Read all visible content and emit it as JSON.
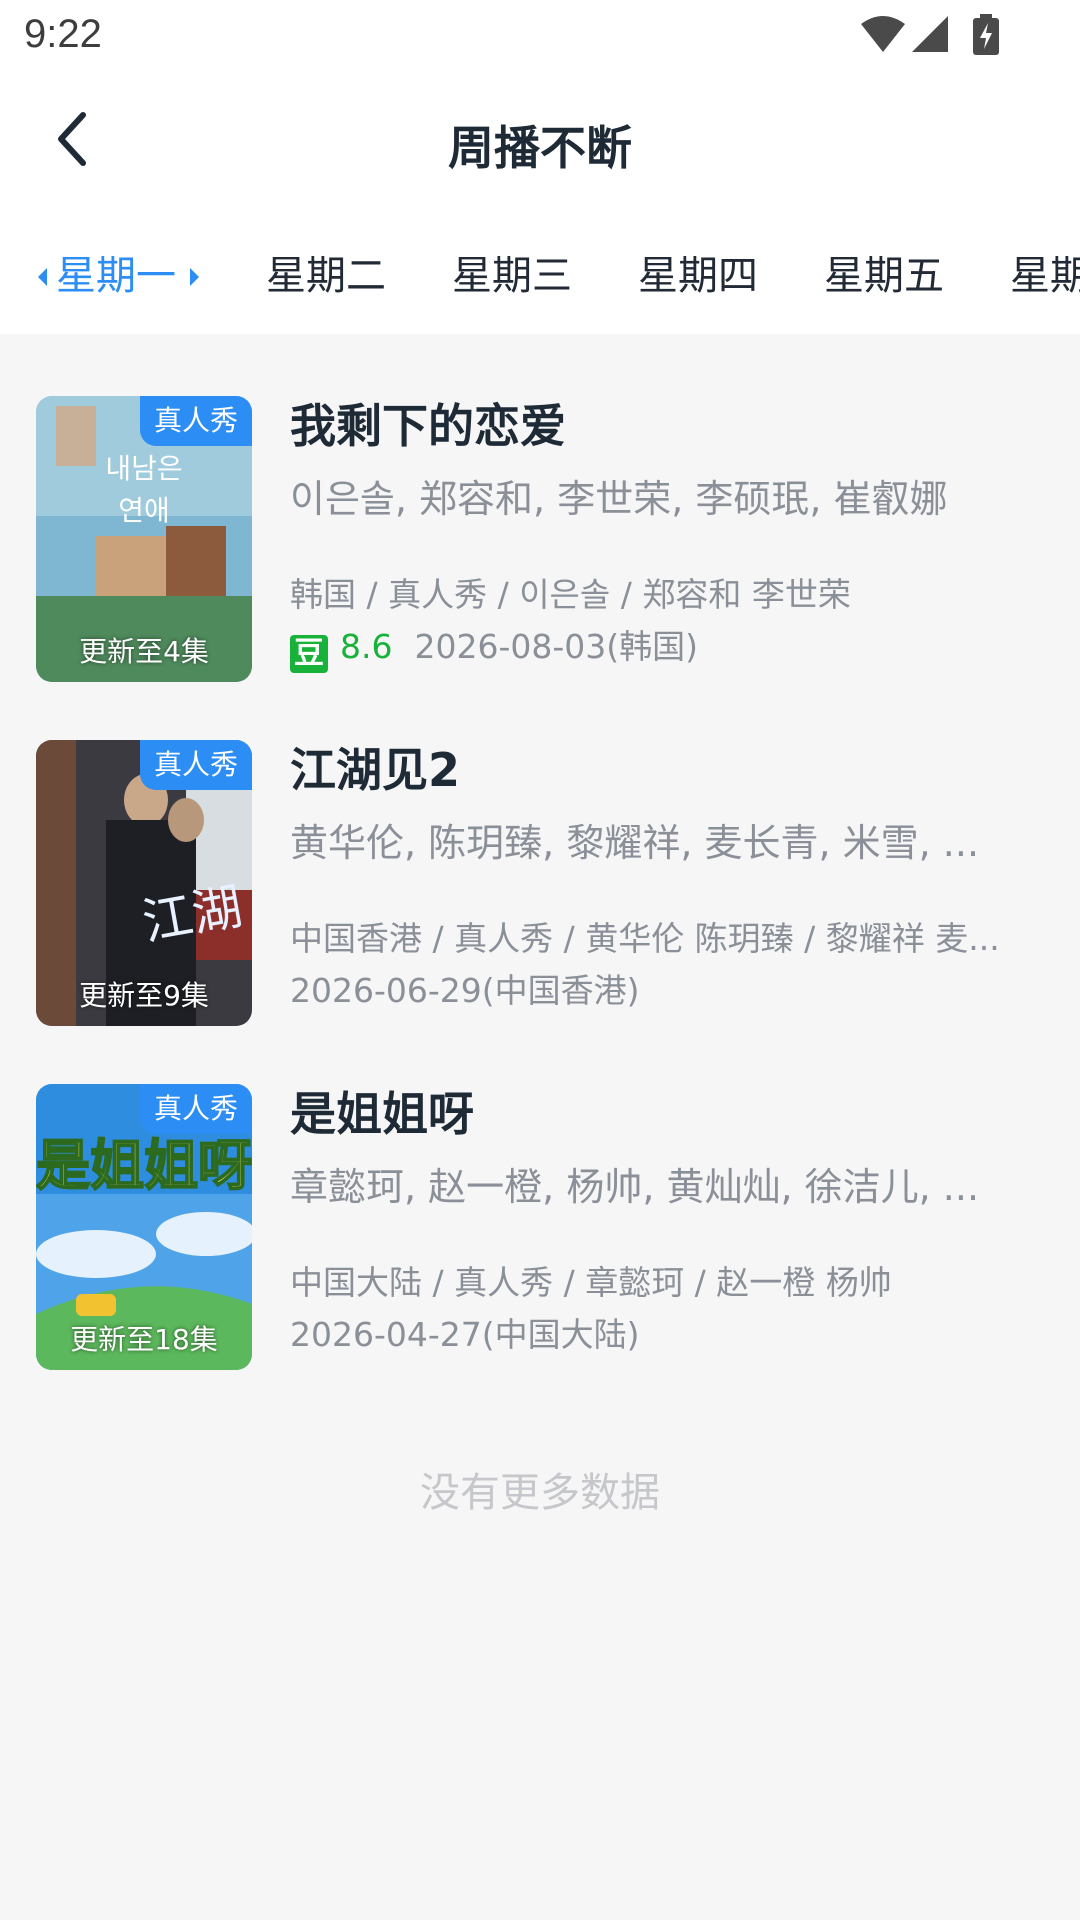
{
  "status_bar": {
    "time": "9:22",
    "icons": [
      "wifi-icon",
      "signal-icon",
      "battery-charging-icon"
    ]
  },
  "header": {
    "title": "周播不断",
    "back_icon": "chevron-left-icon"
  },
  "tabs": [
    {
      "label": "星期一",
      "active": true
    },
    {
      "label": "星期二",
      "active": false
    },
    {
      "label": "星期三",
      "active": false
    },
    {
      "label": "星期四",
      "active": false
    },
    {
      "label": "星期五",
      "active": false
    },
    {
      "label": "星期",
      "active": false
    }
  ],
  "items": [
    {
      "title": "我剩下的恋爱",
      "tag": "真人秀",
      "episode": "更新至4集",
      "cast": "이은솔, 郑容和, 李世荣, 李硕珉, 崔叡娜",
      "meta": "韩国 / 真人秀 / 이은솔 / 郑容和 李世荣",
      "douban_badge": "豆",
      "rating": "8.6",
      "date": "2026-08-03(韩国)"
    },
    {
      "title": "江湖见2",
      "tag": "真人秀",
      "episode": "更新至9集",
      "cast": "黄华伦, 陈玥臻, 黎耀祥, 麦长青, 米雪, ...",
      "meta": "中国香港 / 真人秀 / 黄华伦 陈玥臻 / 黎耀祥 麦...",
      "date": "2026-06-29(中国香港)"
    },
    {
      "title": "是姐姐呀",
      "tag": "真人秀",
      "episode": "更新至18集",
      "cast": "章懿珂, 赵一橙, 杨帅, 黄灿灿, 徐洁儿, ...",
      "meta": "中国大陆 / 真人秀 / 章懿珂 / 赵一橙 杨帅",
      "date": "2026-04-27(中国大陆)"
    }
  ],
  "footer": {
    "no_more": "没有更多数据"
  },
  "colors": {
    "accent": "#2c8ef5",
    "douban_green": "#18b23a",
    "background": "#f6f6f6"
  }
}
